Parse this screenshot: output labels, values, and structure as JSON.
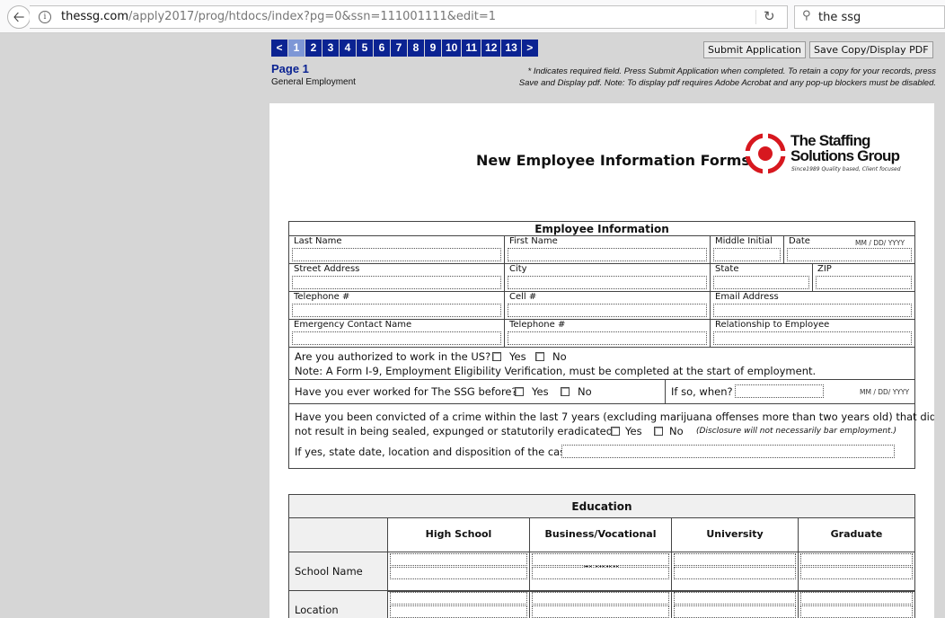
{
  "browser": {
    "url_prefix": "thessg.com",
    "url_rest": "/apply2017/prog/htdocs/index?pg=0&ssn=111001111&edit=1",
    "search_value": "the ssg"
  },
  "nav": {
    "pages": [
      "<",
      "1",
      "2",
      "3",
      "4",
      "5",
      "6",
      "7",
      "8",
      "9",
      "10",
      "11",
      "12",
      "13",
      ">"
    ],
    "active_page": "1",
    "submit_label": "Submit Application",
    "save_label": "Save Copy/Display PDF"
  },
  "page": {
    "title": "Page 1",
    "subtitle": "General Employment",
    "note_line1": "* Indicates required field. Press Submit Application when completed. To retain a copy for your records, press",
    "note_line2": "Save and Display pdf. Note: To display pdf requires Adobe Acrobat and any pop-up blockers must be disabled."
  },
  "form": {
    "title": "New Employee Information Forms",
    "logo_line1": "The Staffing",
    "logo_line2": "Solutions Group",
    "logo_tagline": "Since1989 Quality based, Client focused",
    "employee": {
      "heading": "Employee Information",
      "last_name": "Last Name",
      "first_name": "First Name",
      "middle_initial": "Middle Initial",
      "date": "Date",
      "date_hint": "MM / DD/ YYYY",
      "street": "Street Address",
      "city": "City",
      "state": "State",
      "zip": "ZIP",
      "telephone": "Telephone #",
      "cell": "Cell #",
      "email": "Email Address",
      "emergency_name": "Emergency Contact Name",
      "emergency_phone": "Telephone #",
      "relationship": "Relationship to Employee",
      "auth_question": "Are you authorized to work in the US?",
      "yes": "Yes",
      "no": "No",
      "i9_note": "Note:  A Form I-9, Employment Eligibility Verification, must be completed at the start of employment.",
      "worked_question": "Have you ever worked for The SSG before?",
      "if_so_when": "If so, when?",
      "when_hint": "MM / DD/ YYYY",
      "convicted_line1": "Have you been convicted of a crime within the last 7 years (excluding marijuana offenses more than two years old) that did",
      "convicted_line2": "not result in being sealed, expunged or statutorily eradicated?",
      "disclosure": "(Disclosure will not necessarily bar employment.)",
      "if_yes_state": "If yes, state date, location and disposition of the case."
    },
    "education": {
      "heading": "Education",
      "columns": [
        "High School",
        "Business/Vocational School",
        "University",
        "Graduate"
      ],
      "rows": [
        "School Name",
        "Location"
      ]
    }
  },
  "colors": {
    "nav_blue": "#0b2392",
    "nav_active": "#7e97d6",
    "logo_red": "#d7181f"
  }
}
